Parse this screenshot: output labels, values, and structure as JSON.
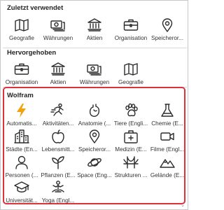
{
  "colors": {
    "icon": "#2b2b2b",
    "bolt": "#f2a20c",
    "highlight": "#e0303a"
  },
  "recent": {
    "title": "Zuletzt verwendet",
    "items": [
      {
        "label": "Geografie",
        "icon": "map-icon"
      },
      {
        "label": "Währungen",
        "icon": "currency-icon"
      },
      {
        "label": "Aktien",
        "icon": "bank-icon"
      },
      {
        "label": "Organisation",
        "icon": "briefcase-icon"
      },
      {
        "label": "Speicheror...",
        "icon": "location-pin-icon"
      }
    ]
  },
  "featured": {
    "title": "Hervorgehoben",
    "items": [
      {
        "label": "Organisation",
        "icon": "briefcase-icon"
      },
      {
        "label": "Aktien",
        "icon": "bank-icon"
      },
      {
        "label": "Währungen",
        "icon": "currency-icon"
      },
      {
        "label": "Geografie",
        "icon": "map-icon"
      }
    ]
  },
  "wolfram": {
    "title": "Wolfram",
    "items": [
      {
        "label": "Automatis...",
        "icon": "lightning-icon"
      },
      {
        "label": "Aktivitäten...",
        "icon": "runner-icon"
      },
      {
        "label": "Anatomie (...",
        "icon": "heart-icon"
      },
      {
        "label": "Tiere (Engli...",
        "icon": "paw-icon"
      },
      {
        "label": "Chemie (E...",
        "icon": "flask-icon"
      },
      {
        "label": "Städte (En...",
        "icon": "city-icon"
      },
      {
        "label": "Lebensmitt...",
        "icon": "apple-icon"
      },
      {
        "label": "Speicheror...",
        "icon": "location-pin-icon"
      },
      {
        "label": "Medizin (E...",
        "icon": "medical-kit-icon"
      },
      {
        "label": "Filme (Engl...",
        "icon": "video-camera-icon"
      },
      {
        "label": "Personen (...",
        "icon": "person-icon"
      },
      {
        "label": "Pflanzen (E...",
        "icon": "plant-icon"
      },
      {
        "label": "Space (Eng...",
        "icon": "planet-icon"
      },
      {
        "label": "Strukturen ...",
        "icon": "bridge-icon"
      },
      {
        "label": "Gelände (E...",
        "icon": "mountain-icon"
      },
      {
        "label": "Universität...",
        "icon": "graduation-cap-icon"
      },
      {
        "label": "Yoga (Engl...",
        "icon": "yoga-icon"
      }
    ]
  },
  "scroll_indicator": "⌄"
}
